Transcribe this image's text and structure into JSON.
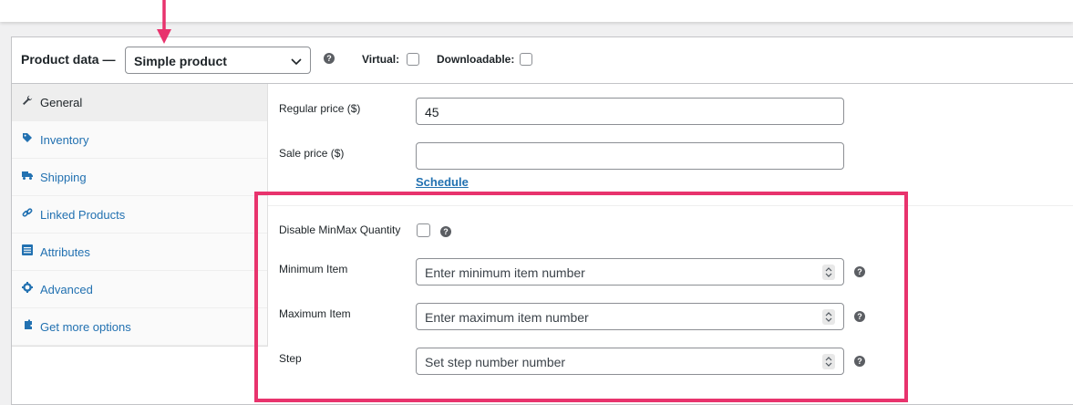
{
  "header": {
    "title": "Product data —",
    "product_type": "Simple product",
    "help_glyph": "?",
    "virtual_label": "Virtual:",
    "downloadable_label": "Downloadable:"
  },
  "tabs": [
    {
      "label": "General",
      "icon": "wrench-icon",
      "active": true
    },
    {
      "label": "Inventory",
      "icon": "tag-icon",
      "active": false
    },
    {
      "label": "Shipping",
      "icon": "truck-icon",
      "active": false
    },
    {
      "label": "Linked Products",
      "icon": "link-icon",
      "active": false
    },
    {
      "label": "Attributes",
      "icon": "list-icon",
      "active": false
    },
    {
      "label": "Advanced",
      "icon": "gear-icon",
      "active": false
    },
    {
      "label": "Get more options",
      "icon": "plugin-icon",
      "active": false
    }
  ],
  "pricing": {
    "regular_label": "Regular price ($)",
    "regular_value": "45",
    "sale_label": "Sale price ($)",
    "sale_value": "",
    "schedule_link": "Schedule"
  },
  "minmax": {
    "disable_label": "Disable MinMax Quantity",
    "min_label": "Minimum Item",
    "min_placeholder": "Enter minimum item number",
    "max_label": "Maximum Item",
    "max_placeholder": "Enter maximum item number",
    "step_label": "Step",
    "step_placeholder": "Set step number number"
  },
  "colors": {
    "link": "#2271b1",
    "annotation": "#e8336d"
  }
}
